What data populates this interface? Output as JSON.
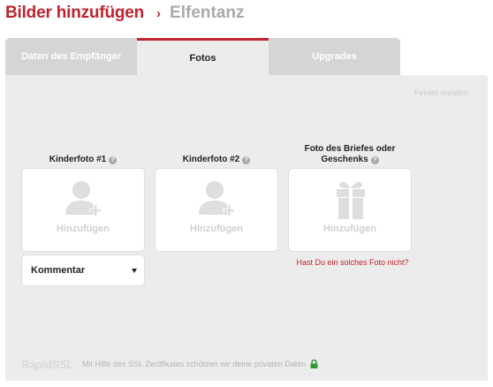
{
  "header": {
    "title": "Bilder hinzufügen",
    "separator": "›",
    "subtitle": "Elfentanz"
  },
  "tabs": [
    {
      "label": "Daten des Empfänger",
      "active": false
    },
    {
      "label": "Fotos",
      "active": true
    },
    {
      "label": "Upgrades",
      "active": false
    }
  ],
  "report_link": "Fehler melden",
  "slots": [
    {
      "label": "Kinderfoto #1",
      "help": "?",
      "add_label": "Hinzufügen",
      "icon": "person-add-icon"
    },
    {
      "label": "Kinderfoto #2",
      "help": "?",
      "add_label": "Hinzufügen",
      "icon": "person-add-icon"
    },
    {
      "label_line1": "Foto des Briefes oder",
      "label_line2": "Geschenks",
      "help": "?",
      "add_label": "Hinzufügen",
      "icon": "gift-icon"
    }
  ],
  "comment_select": {
    "value": "Kommentar"
  },
  "missing_photo_link": "Hast Du ein solches Foto nicht?",
  "footer": {
    "ssl_logo": "RapidSSL",
    "ssl_text": "Mit Hilfe des SSL Zertifikates schützen wir deine privaten Daten",
    "lock_icon": "lock-icon"
  },
  "colors": {
    "brand": "#c0242f",
    "panel": "#ececec",
    "tab_inactive": "#d5d5d5",
    "ssl_lock": "#2e9a2e"
  }
}
